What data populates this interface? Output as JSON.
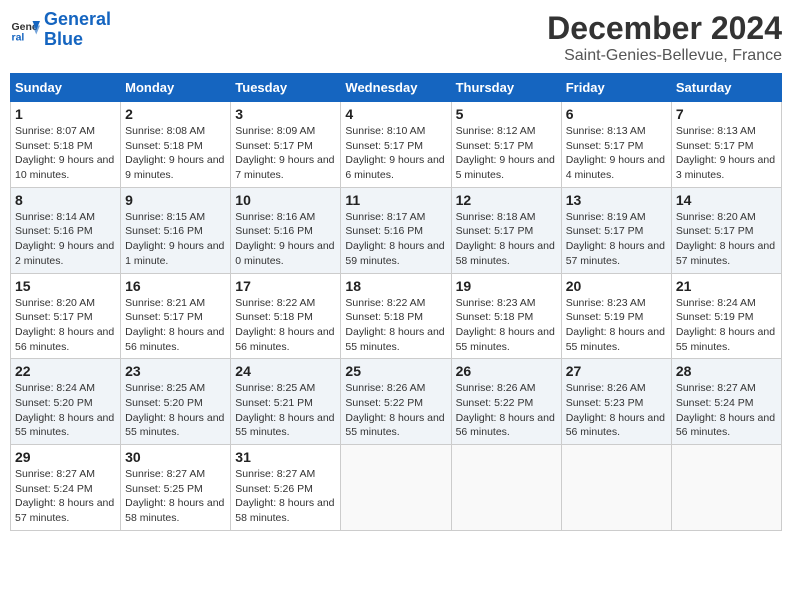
{
  "header": {
    "logo_line1": "General",
    "logo_line2": "Blue",
    "month": "December 2024",
    "location": "Saint-Genies-Bellevue, France"
  },
  "weekdays": [
    "Sunday",
    "Monday",
    "Tuesday",
    "Wednesday",
    "Thursday",
    "Friday",
    "Saturday"
  ],
  "weeks": [
    [
      {
        "day": "1",
        "info": "Sunrise: 8:07 AM\nSunset: 5:18 PM\nDaylight: 9 hours and 10 minutes."
      },
      {
        "day": "2",
        "info": "Sunrise: 8:08 AM\nSunset: 5:18 PM\nDaylight: 9 hours and 9 minutes."
      },
      {
        "day": "3",
        "info": "Sunrise: 8:09 AM\nSunset: 5:17 PM\nDaylight: 9 hours and 7 minutes."
      },
      {
        "day": "4",
        "info": "Sunrise: 8:10 AM\nSunset: 5:17 PM\nDaylight: 9 hours and 6 minutes."
      },
      {
        "day": "5",
        "info": "Sunrise: 8:12 AM\nSunset: 5:17 PM\nDaylight: 9 hours and 5 minutes."
      },
      {
        "day": "6",
        "info": "Sunrise: 8:13 AM\nSunset: 5:17 PM\nDaylight: 9 hours and 4 minutes."
      },
      {
        "day": "7",
        "info": "Sunrise: 8:13 AM\nSunset: 5:17 PM\nDaylight: 9 hours and 3 minutes."
      }
    ],
    [
      {
        "day": "8",
        "info": "Sunrise: 8:14 AM\nSunset: 5:16 PM\nDaylight: 9 hours and 2 minutes."
      },
      {
        "day": "9",
        "info": "Sunrise: 8:15 AM\nSunset: 5:16 PM\nDaylight: 9 hours and 1 minute."
      },
      {
        "day": "10",
        "info": "Sunrise: 8:16 AM\nSunset: 5:16 PM\nDaylight: 9 hours and 0 minutes."
      },
      {
        "day": "11",
        "info": "Sunrise: 8:17 AM\nSunset: 5:16 PM\nDaylight: 8 hours and 59 minutes."
      },
      {
        "day": "12",
        "info": "Sunrise: 8:18 AM\nSunset: 5:17 PM\nDaylight: 8 hours and 58 minutes."
      },
      {
        "day": "13",
        "info": "Sunrise: 8:19 AM\nSunset: 5:17 PM\nDaylight: 8 hours and 57 minutes."
      },
      {
        "day": "14",
        "info": "Sunrise: 8:20 AM\nSunset: 5:17 PM\nDaylight: 8 hours and 57 minutes."
      }
    ],
    [
      {
        "day": "15",
        "info": "Sunrise: 8:20 AM\nSunset: 5:17 PM\nDaylight: 8 hours and 56 minutes."
      },
      {
        "day": "16",
        "info": "Sunrise: 8:21 AM\nSunset: 5:17 PM\nDaylight: 8 hours and 56 minutes."
      },
      {
        "day": "17",
        "info": "Sunrise: 8:22 AM\nSunset: 5:18 PM\nDaylight: 8 hours and 56 minutes."
      },
      {
        "day": "18",
        "info": "Sunrise: 8:22 AM\nSunset: 5:18 PM\nDaylight: 8 hours and 55 minutes."
      },
      {
        "day": "19",
        "info": "Sunrise: 8:23 AM\nSunset: 5:18 PM\nDaylight: 8 hours and 55 minutes."
      },
      {
        "day": "20",
        "info": "Sunrise: 8:23 AM\nSunset: 5:19 PM\nDaylight: 8 hours and 55 minutes."
      },
      {
        "day": "21",
        "info": "Sunrise: 8:24 AM\nSunset: 5:19 PM\nDaylight: 8 hours and 55 minutes."
      }
    ],
    [
      {
        "day": "22",
        "info": "Sunrise: 8:24 AM\nSunset: 5:20 PM\nDaylight: 8 hours and 55 minutes."
      },
      {
        "day": "23",
        "info": "Sunrise: 8:25 AM\nSunset: 5:20 PM\nDaylight: 8 hours and 55 minutes."
      },
      {
        "day": "24",
        "info": "Sunrise: 8:25 AM\nSunset: 5:21 PM\nDaylight: 8 hours and 55 minutes."
      },
      {
        "day": "25",
        "info": "Sunrise: 8:26 AM\nSunset: 5:22 PM\nDaylight: 8 hours and 55 minutes."
      },
      {
        "day": "26",
        "info": "Sunrise: 8:26 AM\nSunset: 5:22 PM\nDaylight: 8 hours and 56 minutes."
      },
      {
        "day": "27",
        "info": "Sunrise: 8:26 AM\nSunset: 5:23 PM\nDaylight: 8 hours and 56 minutes."
      },
      {
        "day": "28",
        "info": "Sunrise: 8:27 AM\nSunset: 5:24 PM\nDaylight: 8 hours and 56 minutes."
      }
    ],
    [
      {
        "day": "29",
        "info": "Sunrise: 8:27 AM\nSunset: 5:24 PM\nDaylight: 8 hours and 57 minutes."
      },
      {
        "day": "30",
        "info": "Sunrise: 8:27 AM\nSunset: 5:25 PM\nDaylight: 8 hours and 58 minutes."
      },
      {
        "day": "31",
        "info": "Sunrise: 8:27 AM\nSunset: 5:26 PM\nDaylight: 8 hours and 58 minutes."
      },
      {
        "day": "",
        "info": ""
      },
      {
        "day": "",
        "info": ""
      },
      {
        "day": "",
        "info": ""
      },
      {
        "day": "",
        "info": ""
      }
    ]
  ]
}
